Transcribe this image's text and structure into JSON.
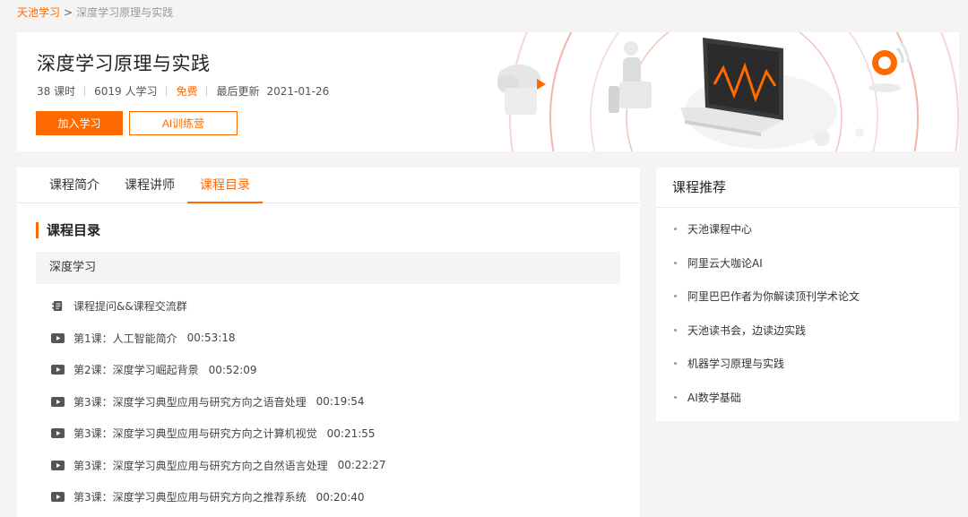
{
  "breadcrumb": {
    "home": "天池学习",
    "separator": ">",
    "current": "深度学习原理与实践"
  },
  "course": {
    "title": "深度学习原理与实践",
    "lessons_count": "38 课时",
    "learners": "6019 人学习",
    "price": "免费",
    "updated_label": "最后更新",
    "updated_date": "2021-01-26",
    "join_button": "加入学习",
    "camp_button": "AI训练营"
  },
  "tabs": [
    {
      "label": "课程简介",
      "active": false
    },
    {
      "label": "课程讲师",
      "active": false
    },
    {
      "label": "课程目录",
      "active": true
    }
  ],
  "catalog": {
    "heading": "课程目录",
    "chapter": "深度学习",
    "items": [
      {
        "icon": "chat-group-icon",
        "title": "课程提问&&课程交流群",
        "duration": ""
      },
      {
        "icon": "video-icon",
        "title": "第1课：人工智能简介",
        "duration": "00:53:18"
      },
      {
        "icon": "video-icon",
        "title": "第2课：深度学习崛起背景",
        "duration": "00:52:09"
      },
      {
        "icon": "video-icon",
        "title": "第3课：深度学习典型应用与研究方向之语音处理",
        "duration": "00:19:54"
      },
      {
        "icon": "video-icon",
        "title": "第3课：深度学习典型应用与研究方向之计算机视觉",
        "duration": "00:21:55"
      },
      {
        "icon": "video-icon",
        "title": "第3课：深度学习典型应用与研究方向之自然语言处理",
        "duration": "00:22:27"
      },
      {
        "icon": "video-icon",
        "title": "第3课：深度学习典型应用与研究方向之推荐系统",
        "duration": "00:20:40"
      }
    ]
  },
  "recommend": {
    "title": "课程推荐",
    "items": [
      "天池课程中心",
      "阿里云大咖论AI",
      "阿里巴巴作者为你解读顶刊学术论文",
      "天池读书会，边读边实践",
      "机器学习原理与实践",
      "AI数学基础"
    ]
  },
  "colors": {
    "accent": "#ff6a00",
    "page_bg": "#f4f4f4",
    "chapter_bg": "#f4f4f4"
  }
}
